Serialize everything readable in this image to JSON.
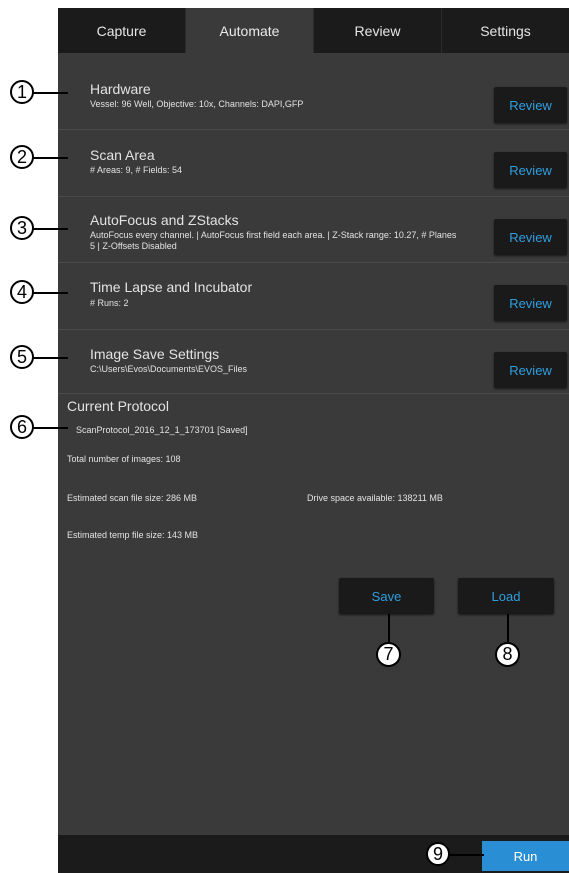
{
  "tabs": [
    {
      "label": "Capture"
    },
    {
      "label": "Automate"
    },
    {
      "label": "Review"
    },
    {
      "label": "Settings"
    }
  ],
  "sections": [
    {
      "title": "Hardware",
      "desc": "Vessel: 96 Well, Objective: 10x, Channels: DAPI,GFP",
      "button": "Review"
    },
    {
      "title": "Scan Area",
      "desc": "# Areas: 9, # Fields: 54",
      "button": "Review"
    },
    {
      "title": "AutoFocus and ZStacks",
      "desc": "AutoFocus every channel. | AutoFocus first field each area. | Z-Stack range: 10.27, # Planes 5 | Z-Offsets Disabled",
      "button": "Review"
    },
    {
      "title": "Time Lapse and Incubator",
      "desc": "# Runs: 2",
      "button": "Review"
    },
    {
      "title": "Image Save Settings",
      "desc": "C:\\Users\\Evos\\Documents\\EVOS_Files",
      "button": "Review"
    }
  ],
  "protocol": {
    "heading": "Current Protocol",
    "name": "ScanProtocol_2016_12_1_173701 [Saved]",
    "total_images": "Total number of images: 108",
    "scan_size": "Estimated scan file size: 286 MB",
    "drive_space": "Drive space available: 138211 MB",
    "temp_size": "Estimated temp file size: 143 MB"
  },
  "actions": {
    "save": "Save",
    "load": "Load",
    "run": "Run"
  },
  "callouts": [
    "1",
    "2",
    "3",
    "4",
    "5",
    "6",
    "7",
    "8",
    "9"
  ],
  "colors": {
    "panel": "#3a3a3a",
    "tabbar": "#1b1b1b",
    "accent": "#2f9fe0",
    "run": "#2a8ed4"
  }
}
